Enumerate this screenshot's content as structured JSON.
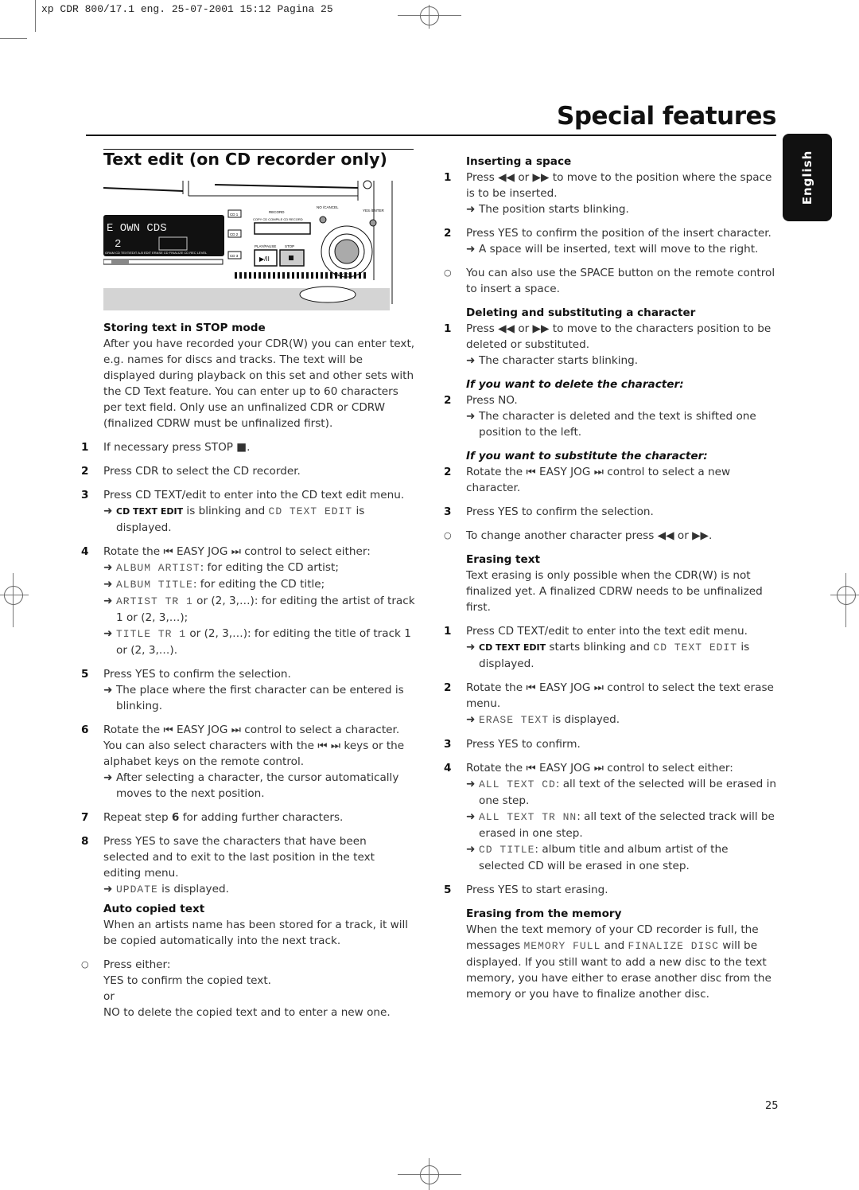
{
  "slug": "xp CDR 800/17.1 eng.  25-07-2001 15:12  Pagina 25",
  "page_title": "Special features",
  "language_tab": "English",
  "section_title": "Text edit (on CD recorder only)",
  "page_number": "25",
  "illustration": {
    "display_text": "E OWN CDS",
    "display_number": "2",
    "buttons": [
      "CD 1",
      "CD 2",
      "CD 3"
    ],
    "record_group": "RECORD",
    "record_buttons": [
      "COPY CD",
      "COMPILE CD",
      "RECORD"
    ],
    "no_cancel": "NO /CANCEL",
    "yes_enter": "YES /ENTER",
    "play_pause": "PLAY/PAUSE",
    "stop": "STOP",
    "easy_jog": "EASY JOG",
    "bottom_labels": [
      "GRAM",
      "CD TEXT/ EDIT",
      "A-B EDIT",
      "ERASE CD",
      "FINALIZE CD",
      "REC LEVEL"
    ]
  },
  "left": {
    "storing_heading": "Storing text in STOP mode",
    "storing_body": "After you have recorded your CDR(W) you can enter text, e.g. names for discs and tracks. The text will be displayed during playback on this set and other sets with the CD Text feature. You can enter up to 60 characters per text field. Only use an unfinalized CDR or CDRW (finalized CDRW must be unfinalized first).",
    "s1": "If necessary press STOP ■.",
    "s2": "Press CDR to select the CD recorder.",
    "s3": "Press CD TEXT/edit to enter into the CD text edit menu.",
    "s3_r_bold": "CD TEXT EDIT",
    "s3_r_mid": " is blinking and ",
    "s3_r_lcd": "CD TEXT EDIT",
    "s3_r_end": " is displayed.",
    "s4": "Rotate the ⏮ EASY JOG ⏭ control to select either:",
    "s4_opts": [
      {
        "lcd": "ALBUM ARTIST",
        "text": ": for editing the CD artist;"
      },
      {
        "lcd": "ALBUM TITLE",
        "text": ": for editing the CD title;"
      },
      {
        "lcd": "ARTIST TR  1",
        "text": " or (2, 3,…): for editing the artist of track 1 or (2, 3,…);"
      },
      {
        "lcd": "TITLE TR  1",
        "text": " or (2, 3,…): for editing the title of track 1 or (2, 3,…)."
      }
    ],
    "s5": "Press YES to confirm the selection.",
    "s5_r": "The place where the first character can be entered is blinking.",
    "s6": "Rotate the ⏮ EASY JOG ⏭ control to select a character. You can also select characters with the ⏮ ⏭ keys or the alphabet keys on the remote control.",
    "s6_r": "After selecting a character, the cursor automatically moves to the next position.",
    "s7_a": "Repeat step ",
    "s7_b": "6",
    "s7_c": " for adding further characters.",
    "s8": "Press YES to save the characters that have been selected and to exit to the last position in the text editing menu.",
    "s8_r_lcd": "UPDATE",
    "s8_r_end": " is displayed.",
    "auto_heading": "Auto copied text",
    "auto_body": "When an artists name has been stored for a track, it will be copied automatically into the next track.",
    "auto_step": [
      "Press either:",
      "YES to confirm the copied text.",
      "or",
      "NO to delete the copied text and to enter a new one."
    ]
  },
  "right": {
    "insert_heading": "Inserting a space",
    "i1": "Press ◀◀ or ▶▶ to move to the position where the space is to be inserted.",
    "i1_r": "The position starts blinking.",
    "i2": "Press YES to confirm the position of the insert character.",
    "i2_r": "A space will be inserted, text will move to the right.",
    "i_note": "You can also use the SPACE button on the remote control to insert a space.",
    "del_heading": "Deleting and substituting a character",
    "d1": "Press ◀◀ or ▶▶ to move to the characters position to be deleted or substituted.",
    "d1_r": "The character starts blinking.",
    "del_sub1": "If you want to delete the character:",
    "d2": "Press NO.",
    "d2_r": "The character is deleted and the text is shifted one position to the left.",
    "del_sub2": "If you want to substitute the character:",
    "d2b": "Rotate the ⏮ EASY JOG ⏭ control to select a new character.",
    "d3": "Press YES to confirm the selection.",
    "d_note": "To change another character press ◀◀ or ▶▶.",
    "erase_heading": "Erasing text",
    "erase_body": "Text erasing is only possible when the CDR(W) is not finalized yet. A finalized CDRW needs to be unfinalized first.",
    "e1": "Press CD TEXT/edit  to enter into the text edit menu.",
    "e1_r_bold": "CD TEXT EDIT",
    "e1_r_mid": " starts blinking and ",
    "e1_r_lcd": "CD TEXT EDIT",
    "e1_r_end": " is displayed.",
    "e2": "Rotate the ⏮ EASY JOG ⏭ control to select the text erase menu.",
    "e2_r_lcd": "ERASE TEXT",
    "e2_r_end": " is displayed.",
    "e3": "Press YES to confirm.",
    "e4": "Rotate the ⏮ EASY JOG ⏭ control to select either:",
    "e4_opts": [
      {
        "lcd": "ALL TEXT CD",
        "text": ": all text of the selected will be erased in one step."
      },
      {
        "lcd": "ALL TEXT TR NN",
        "text": ": all text of the selected track will be erased in one step."
      },
      {
        "lcd": "CD TITLE",
        "text": ": album title and album artist of the selected CD will be erased in one step."
      }
    ],
    "e5": "Press YES to start erasing.",
    "mem_heading": "Erasing from the memory",
    "mem_a": "When the text memory of your CD recorder is full, the messages ",
    "mem_lcd1": "MEMORY FULL",
    "mem_b": " and ",
    "mem_lcd2": "FINALIZE DISC",
    "mem_c": " will be displayed. If you still want to add a new disc to the text memory, you have either to erase another disc from the memory or you have to finalize another disc."
  }
}
